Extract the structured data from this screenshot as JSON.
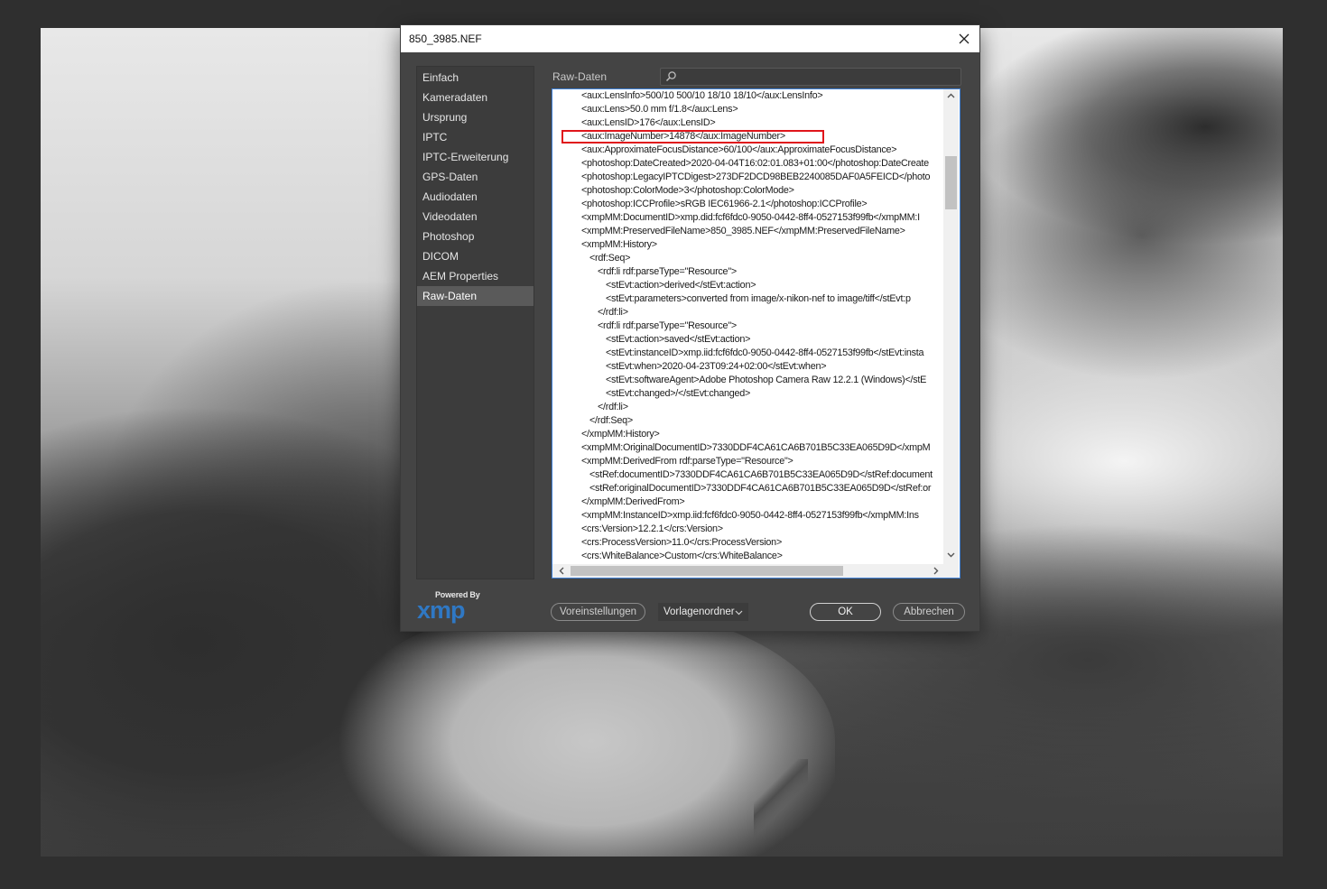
{
  "dialog": {
    "title": "850_3985.NEF",
    "section_label": "Raw-Daten",
    "search_placeholder": ""
  },
  "sidebar": {
    "items": [
      {
        "label": "Einfach",
        "active": false
      },
      {
        "label": "Kameradaten",
        "active": false
      },
      {
        "label": "Ursprung",
        "active": false
      },
      {
        "label": "IPTC",
        "active": false
      },
      {
        "label": "IPTC-Erweiterung",
        "active": false
      },
      {
        "label": "GPS-Daten",
        "active": false
      },
      {
        "label": "Audiodaten",
        "active": false
      },
      {
        "label": "Videodaten",
        "active": false
      },
      {
        "label": "Photoshop",
        "active": false
      },
      {
        "label": "DICOM",
        "active": false
      },
      {
        "label": "AEM Properties",
        "active": false
      },
      {
        "label": "Raw-Daten",
        "active": true
      }
    ]
  },
  "raw": {
    "highlighted_line_index": 3,
    "lines": [
      {
        "indent": 0,
        "text": "<aux:LensInfo>500/10 500/10 18/10 18/10</aux:LensInfo>"
      },
      {
        "indent": 0,
        "text": "<aux:Lens>50.0 mm f/1.8</aux:Lens>"
      },
      {
        "indent": 0,
        "text": "<aux:LensID>176</aux:LensID>"
      },
      {
        "indent": 0,
        "text": "<aux:ImageNumber>14878</aux:ImageNumber>"
      },
      {
        "indent": 0,
        "text": "<aux:ApproximateFocusDistance>60/100</aux:ApproximateFocusDistance>"
      },
      {
        "indent": 0,
        "text": "<photoshop:DateCreated>2020-04-04T16:02:01.083+01:00</photoshop:DateCreate"
      },
      {
        "indent": 0,
        "text": "<photoshop:LegacyIPTCDigest>273DF2DCD98BEB2240085DAF0A5FEICD</photo"
      },
      {
        "indent": 0,
        "text": "<photoshop:ColorMode>3</photoshop:ColorMode>"
      },
      {
        "indent": 0,
        "text": "<photoshop:ICCProfile>sRGB IEC61966-2.1</photoshop:ICCProfile>"
      },
      {
        "indent": 0,
        "text": "<xmpMM:DocumentID>xmp.did:fcf6fdc0-9050-0442-8ff4-0527153f99fb</xmpMM:I"
      },
      {
        "indent": 0,
        "text": "<xmpMM:PreservedFileName>850_3985.NEF</xmpMM:PreservedFileName>"
      },
      {
        "indent": 0,
        "text": "<xmpMM:History>"
      },
      {
        "indent": 1,
        "text": "<rdf:Seq>"
      },
      {
        "indent": 2,
        "text": "<rdf:li rdf:parseType=\"Resource\">"
      },
      {
        "indent": 3,
        "text": "<stEvt:action>derived</stEvt:action>"
      },
      {
        "indent": 3,
        "text": "<stEvt:parameters>converted from image/x-nikon-nef to image/tiff</stEvt:p"
      },
      {
        "indent": 2,
        "text": "</rdf:li>"
      },
      {
        "indent": 2,
        "text": "<rdf:li rdf:parseType=\"Resource\">"
      },
      {
        "indent": 3,
        "text": "<stEvt:action>saved</stEvt:action>"
      },
      {
        "indent": 3,
        "text": "<stEvt:instanceID>xmp.iid:fcf6fdc0-9050-0442-8ff4-0527153f99fb</stEvt:insta"
      },
      {
        "indent": 3,
        "text": "<stEvt:when>2020-04-23T09:24+02:00</stEvt:when>"
      },
      {
        "indent": 3,
        "text": "<stEvt:softwareAgent>Adobe Photoshop Camera Raw 12.2.1 (Windows)</stE"
      },
      {
        "indent": 3,
        "text": "<stEvt:changed>/</stEvt:changed>"
      },
      {
        "indent": 2,
        "text": "</rdf:li>"
      },
      {
        "indent": 1,
        "text": "</rdf:Seq>"
      },
      {
        "indent": 0,
        "text": "</xmpMM:History>"
      },
      {
        "indent": 0,
        "text": "<xmpMM:OriginalDocumentID>7330DDF4CA61CA6B701B5C33EA065D9D</xmpM"
      },
      {
        "indent": 0,
        "text": "<xmpMM:DerivedFrom rdf:parseType=\"Resource\">"
      },
      {
        "indent": 1,
        "text": "<stRef:documentID>7330DDF4CA61CA6B701B5C33EA065D9D</stRef:document"
      },
      {
        "indent": 1,
        "text": "<stRef:originalDocumentID>7330DDF4CA61CA6B701B5C33EA065D9D</stRef:or"
      },
      {
        "indent": 0,
        "text": "</xmpMM:DerivedFrom>"
      },
      {
        "indent": 0,
        "text": "<xmpMM:InstanceID>xmp.iid:fcf6fdc0-9050-0442-8ff4-0527153f99fb</xmpMM:Ins"
      },
      {
        "indent": 0,
        "text": "<crs:Version>12.2.1</crs:Version>"
      },
      {
        "indent": 0,
        "text": "<crs:ProcessVersion>11.0</crs:ProcessVersion>"
      },
      {
        "indent": 0,
        "text": "<crs:WhiteBalance>Custom</crs:WhiteBalance>"
      }
    ]
  },
  "footer": {
    "powered_by": "Powered By",
    "xmp_logo": "xmp",
    "presets_button": "Voreinstellungen",
    "templates_dropdown": "Vorlagenordner",
    "ok_button": "OK",
    "cancel_button": "Abbrechen"
  },
  "colors": {
    "highlight_box": "#e0151b",
    "xmp_logo": "#2f78c4",
    "focus_border": "#3d7fd6"
  },
  "icons": {
    "close": "close-icon",
    "search": "search-icon",
    "scroll_up": "chevron-up-icon",
    "scroll_down": "chevron-down-icon",
    "scroll_left": "chevron-left-icon",
    "scroll_right": "chevron-right-icon",
    "dropdown": "chevron-down-icon"
  }
}
